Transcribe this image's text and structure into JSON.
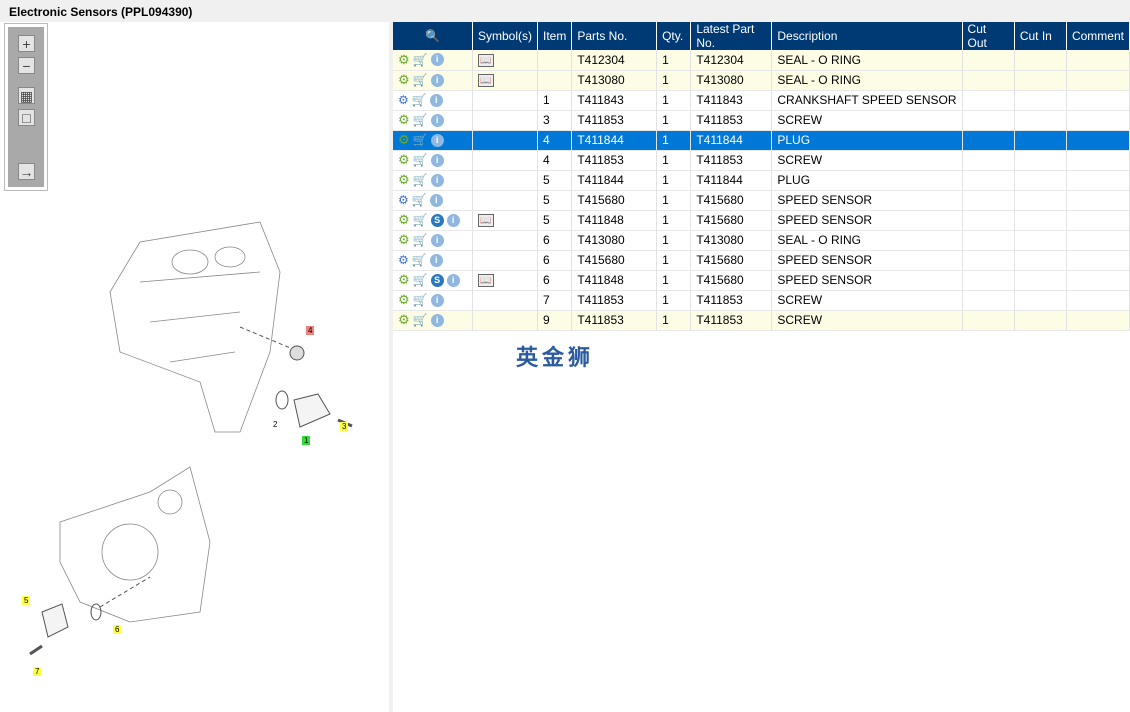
{
  "title": "Electronic Sensors (PPL094390)",
  "toolbar": {
    "zoom_in": "+",
    "zoom_out": "−",
    "fit": "▦",
    "actual": "□",
    "export": "→"
  },
  "diagram": {
    "callouts": [
      "4",
      "1",
      "2",
      "3",
      "5",
      "6",
      "7"
    ]
  },
  "table": {
    "headers": [
      "",
      "Symbol(s)",
      "Item",
      "Parts No.",
      "Qty.",
      "Latest Part No.",
      "Description",
      "Cut Out",
      "Cut In",
      "Comment"
    ],
    "rows": [
      {
        "cls": "yel",
        "gear": "single",
        "s": false,
        "book": true,
        "item": "",
        "part": "T412304",
        "qty": "1",
        "latest": "T412304",
        "desc": "SEAL - O RING"
      },
      {
        "cls": "yel",
        "gear": "single",
        "s": false,
        "book": true,
        "item": "",
        "part": "T413080",
        "qty": "1",
        "latest": "T413080",
        "desc": "SEAL - O RING"
      },
      {
        "cls": "",
        "gear": "multi",
        "s": false,
        "book": false,
        "item": "1",
        "part": "T411843",
        "qty": "1",
        "latest": "T411843",
        "desc": "CRANKSHAFT SPEED SENSOR"
      },
      {
        "cls": "",
        "gear": "single",
        "s": false,
        "book": false,
        "item": "3",
        "part": "T411853",
        "qty": "1",
        "latest": "T411853",
        "desc": "SCREW"
      },
      {
        "cls": "sel",
        "gear": "single",
        "s": false,
        "book": false,
        "item": "4",
        "part": "T411844",
        "qty": "1",
        "latest": "T411844",
        "desc": "PLUG"
      },
      {
        "cls": "",
        "gear": "single",
        "s": false,
        "book": false,
        "item": "4",
        "part": "T411853",
        "qty": "1",
        "latest": "T411853",
        "desc": "SCREW"
      },
      {
        "cls": "",
        "gear": "single",
        "s": false,
        "book": false,
        "item": "5",
        "part": "T411844",
        "qty": "1",
        "latest": "T411844",
        "desc": "PLUG"
      },
      {
        "cls": "",
        "gear": "multi",
        "s": false,
        "book": false,
        "item": "5",
        "part": "T415680",
        "qty": "1",
        "latest": "T415680",
        "desc": "SPEED SENSOR"
      },
      {
        "cls": "",
        "gear": "single",
        "s": true,
        "book": true,
        "item": "5",
        "part": "T411848",
        "qty": "1",
        "latest": "T415680",
        "desc": "SPEED SENSOR"
      },
      {
        "cls": "",
        "gear": "single",
        "s": false,
        "book": false,
        "item": "6",
        "part": "T413080",
        "qty": "1",
        "latest": "T413080",
        "desc": "SEAL - O RING"
      },
      {
        "cls": "",
        "gear": "multi",
        "s": false,
        "book": false,
        "item": "6",
        "part": "T415680",
        "qty": "1",
        "latest": "T415680",
        "desc": "SPEED SENSOR"
      },
      {
        "cls": "",
        "gear": "single",
        "s": true,
        "book": true,
        "item": "6",
        "part": "T411848",
        "qty": "1",
        "latest": "T415680",
        "desc": "SPEED SENSOR"
      },
      {
        "cls": "",
        "gear": "single",
        "s": false,
        "book": false,
        "item": "7",
        "part": "T411853",
        "qty": "1",
        "latest": "T411853",
        "desc": "SCREW"
      },
      {
        "cls": "yel",
        "gear": "single",
        "s": false,
        "book": false,
        "item": "9",
        "part": "T411853",
        "qty": "1",
        "latest": "T411853",
        "desc": "SCREW"
      }
    ]
  },
  "watermark": "英金狮",
  "colors": {
    "header": "#003a75",
    "selected": "#0078d7",
    "highlight": "#fdfde6"
  }
}
